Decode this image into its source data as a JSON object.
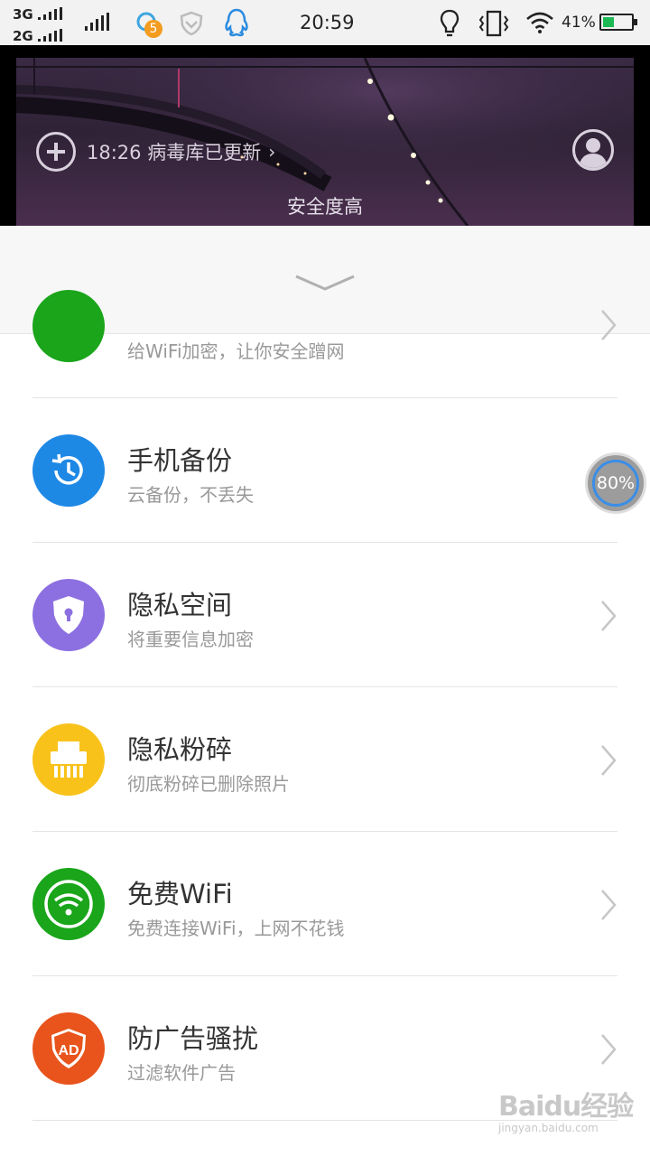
{
  "status_bar": {
    "network_top": "3G",
    "network_bottom": "2G",
    "notification_count": "5",
    "time": "20:59",
    "battery_percent": "41%",
    "battery_level": 0.41
  },
  "hero": {
    "update_text": "18:26 病毒库已更新",
    "safety_text": "安全度高"
  },
  "items": [
    {
      "title": "",
      "subtitle": "给WiFi加密，让你安全蹭网",
      "color": "#1aa51a",
      "icon": "wifi-lock-icon"
    },
    {
      "title": "手机备份",
      "subtitle": "云备份，不丢失",
      "color": "#1e88e5",
      "icon": "backup-clock-icon"
    },
    {
      "title": "隐私空间",
      "subtitle": "将重要信息加密",
      "color": "#8c6fe0",
      "icon": "shield-lock-icon"
    },
    {
      "title": "隐私粉碎",
      "subtitle": "彻底粉碎已删除照片",
      "color": "#f8c21a",
      "icon": "shredder-icon"
    },
    {
      "title": "免费WiFi",
      "subtitle": "免费连接WiFi，上网不花钱",
      "color": "#1aa51a",
      "icon": "wifi-icon"
    },
    {
      "title": "防广告骚扰",
      "subtitle": "过滤软件广告",
      "color": "#e8541c",
      "icon": "ad-shield-icon"
    }
  ],
  "float_badge": {
    "percent": "80%"
  },
  "watermark": {
    "main": "Baidu经验",
    "sub": "jingyan.baidu.com"
  }
}
